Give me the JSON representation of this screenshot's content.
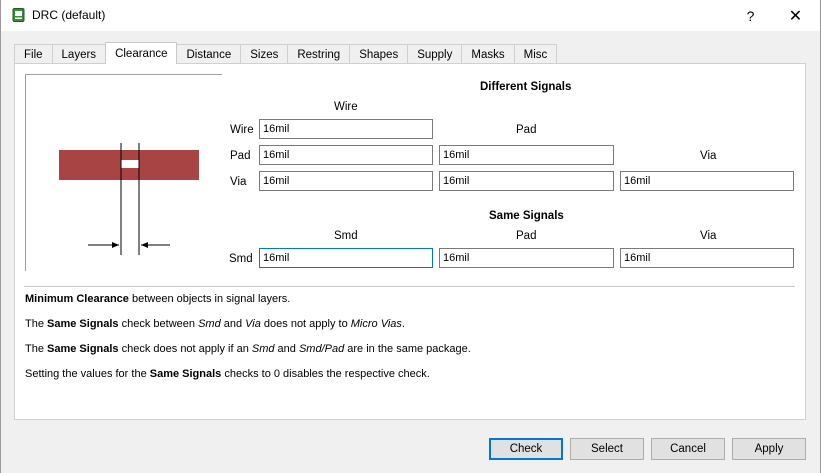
{
  "window": {
    "title": "DRC (default)",
    "help": "?",
    "close": "✕"
  },
  "tabs": [
    "File",
    "Layers",
    "Clearance",
    "Distance",
    "Sizes",
    "Restring",
    "Shapes",
    "Supply",
    "Masks",
    "Misc"
  ],
  "active_tab": "Clearance",
  "different_signals": {
    "header": "Different Signals",
    "col_wire": "Wire",
    "col_pad": "Pad",
    "col_via": "Via",
    "row_wire": "Wire",
    "row_pad": "Pad",
    "row_via": "Via",
    "wire_wire": "16mil",
    "pad_wire": "16mil",
    "pad_pad": "16mil",
    "via_wire": "16mil",
    "via_pad": "16mil",
    "via_via": "16mil"
  },
  "same_signals": {
    "header": "Same Signals",
    "col_smd": "Smd",
    "col_pad": "Pad",
    "col_via": "Via",
    "row_smd": "Smd",
    "smd_smd": "16mil",
    "smd_pad": "16mil",
    "smd_via": "16mil"
  },
  "descriptions": {
    "line1_bold": "Minimum Clearance",
    "line1_rest": " between objects in signal layers.",
    "line2_a": "The ",
    "line2_bold": "Same Signals",
    "line2_b": " check between ",
    "line2_i1": "Smd",
    "line2_c": " and ",
    "line2_i2": "Via",
    "line2_d": " does not apply to ",
    "line2_i3": "Micro Vias",
    "line2_e": ".",
    "line3_a": "The ",
    "line3_bold": "Same Signals",
    "line3_b": " check does not apply if an ",
    "line3_i1": "Smd",
    "line3_c": " and ",
    "line3_i2": "Smd/Pad",
    "line3_d": " are in the same package.",
    "line4_a": "Setting the values for the ",
    "line4_bold": "Same Signals",
    "line4_b": " checks to 0 disables the respective check."
  },
  "buttons": {
    "check": "Check",
    "select": "Select",
    "cancel": "Cancel",
    "apply": "Apply"
  },
  "colors": {
    "trace": "#a94444",
    "focus": "#0078d7"
  },
  "icons": {
    "app": "drc-app-icon",
    "help": "help-icon",
    "close": "close-icon"
  }
}
